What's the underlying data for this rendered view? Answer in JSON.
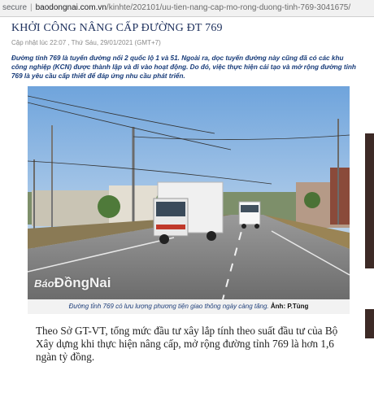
{
  "browser": {
    "security_label": "secure",
    "separator": "|",
    "domain": "baodongnai.com.vn",
    "path": "/kinhte/202101/uu-tien-nang-cap-mo-rong-duong-tinh-769-3041675/"
  },
  "article": {
    "title": "KHỞI CÔNG NÂNG CẤP ĐƯỜNG ĐT 769",
    "updated": "Cập nhật lúc 22:07 , Thứ Sáu, 29/01/2021 (GMT+7)",
    "sapo": "Đường tỉnh 769 là tuyến đường nối 2 quốc lộ 1 và 51. Ngoài ra, dọc tuyến đường này cũng đã có các khu công nghiệp (KCN) được thành lập và đi vào hoạt động. Do đó, việc thực hiện cải tạo và mở rộng đường tỉnh 769 là yêu cầu cấp thiết để đáp ứng nhu cầu phát triển.",
    "photo": {
      "watermark_prefix": "Báo",
      "watermark_name": "ĐồngNai",
      "caption": "Đường tỉnh 769 có lưu lượng phương tiện giao thông ngày càng tăng.",
      "credit": "Ảnh: P.Tùng"
    },
    "body": "Theo Sở GT-VT, tổng mức đầu tư xây lắp tính theo suất đầu tư của Bộ Xây dựng khi thực hiện nâng cấp, mở rộng đường tỉnh 769 là hơn 1,6 ngàn tỷ đồng."
  },
  "colors": {
    "headline": "#1c2f5c",
    "sapo": "#163a78",
    "caption_background": "#f2f2f2"
  }
}
